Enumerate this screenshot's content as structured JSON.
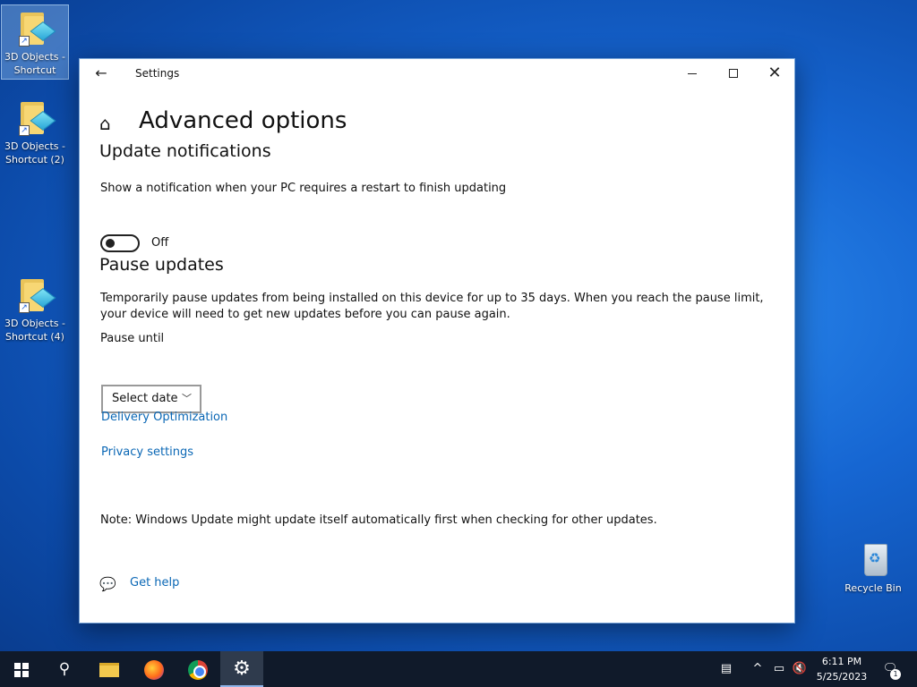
{
  "desktop": {
    "icons": [
      {
        "label": "3D Objects - Shortcut"
      },
      {
        "label": "3D Objects - Shortcut (2)"
      },
      {
        "label": "3D Objects - Shortcut (4)"
      },
      {
        "label": "Recycle Bin"
      }
    ]
  },
  "window": {
    "title": "Settings",
    "back_icon": "arrow-left-icon",
    "controls": {
      "minimize": "minimize-icon",
      "maximize": "maximize-icon",
      "close": "close-icon"
    }
  },
  "page": {
    "title": "Advanced options",
    "home_icon": "home-icon",
    "update_notifications": {
      "heading": "Update notifications",
      "description": "Show a notification when your PC requires a restart to finish updating",
      "toggle_state": "Off"
    },
    "pause_updates": {
      "heading": "Pause updates",
      "description": "Temporarily pause updates from being installed on this device for up to 35 days. When you reach the pause limit, your device will need to get new updates before you can pause again.",
      "pause_until_label": "Pause until",
      "select_value": "Select date"
    },
    "links": {
      "delivery_optimization": "Delivery Optimization",
      "privacy_settings": "Privacy settings"
    },
    "note": "Note: Windows Update might update itself automatically first when checking for other updates.",
    "get_help": "Get help"
  },
  "taskbar": {
    "apps": [
      "start",
      "search",
      "file-explorer",
      "firefox",
      "chrome",
      "settings"
    ],
    "clock": {
      "time": "6:11 PM",
      "date": "5/25/2023"
    },
    "notification_count": "1"
  },
  "colors": {
    "accent_link": "#0a67b5",
    "taskbar": "#101a2a"
  }
}
